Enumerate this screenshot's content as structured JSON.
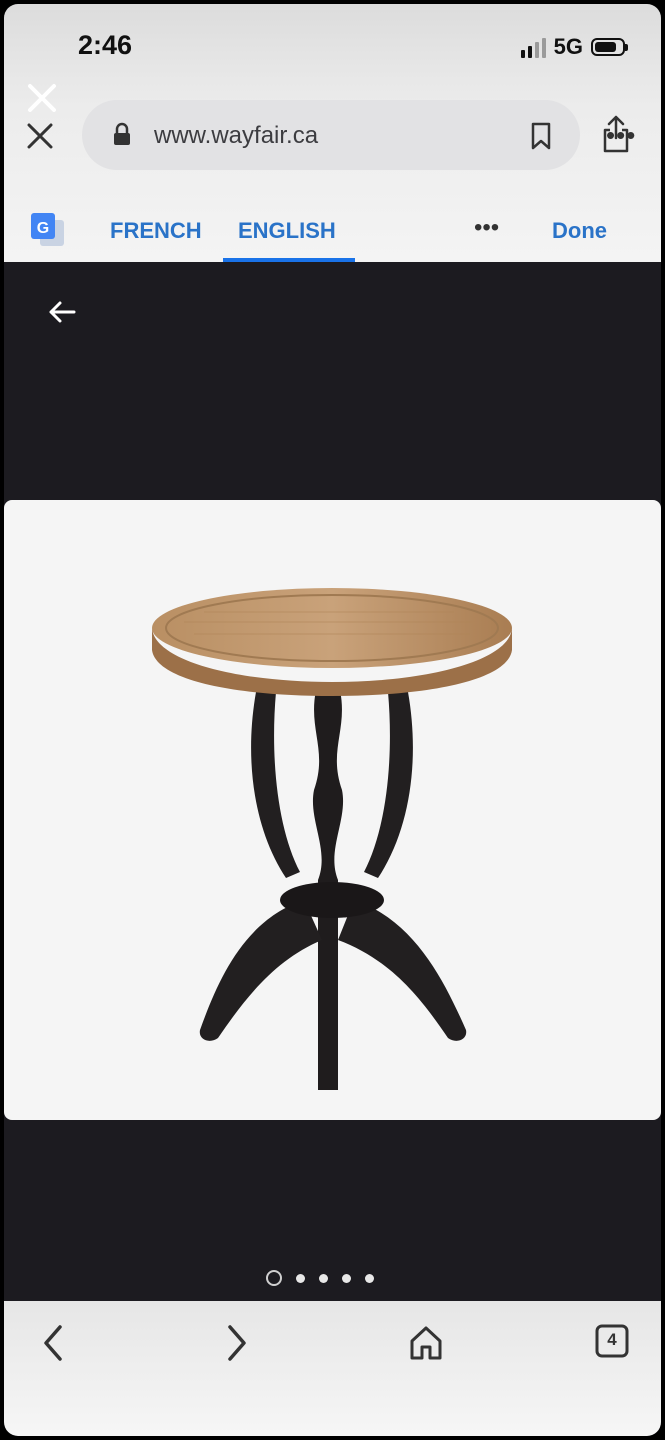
{
  "status_bar": {
    "time": "2:46",
    "network": "5G",
    "battery_level": 0.8
  },
  "browser": {
    "url": "www.wayfair.ca",
    "icons": [
      "close-icon",
      "lock-icon",
      "bookmark-icon",
      "share-icon",
      "more-icon"
    ]
  },
  "translate_bar": {
    "source_language": "FRENCH",
    "target_language": "ENGLISH",
    "selected": "ENGLISH",
    "more_label": "•••",
    "done_label": "Done"
  },
  "page": {
    "product_image": "round wooden side table with dark pedestal base",
    "carousel": {
      "count": 5,
      "active_index": 0
    }
  },
  "bottom_toolbar": {
    "icons": [
      "back-icon",
      "forward-icon",
      "home-icon",
      "tabs-icon"
    ],
    "tab_count": "4"
  },
  "colors": {
    "accent": "#1a73e8",
    "link": "#2a73c8",
    "content_bg": "#1c1b20",
    "card_bg": "#f5f5f5"
  }
}
